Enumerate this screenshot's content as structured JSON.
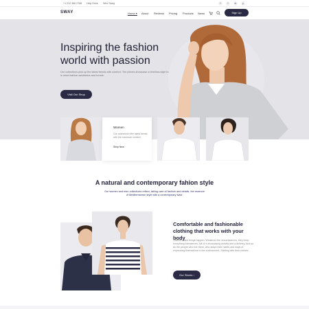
{
  "topbar": {
    "phone": "+1 212 386 2788",
    "help": "Help Desk",
    "location": "Who Sway",
    "social": [
      "f",
      "t",
      "in",
      "y"
    ]
  },
  "nav": {
    "logo": "SWAY",
    "menu": [
      "Home",
      "About",
      "Reviews",
      "Pricing",
      "Products",
      "News"
    ],
    "active_index": 0,
    "cart_icon": "cart-icon",
    "search_icon": "search-icon",
    "signup_label": "Sign Up"
  },
  "hero": {
    "title": "Inspiring the fashion world with passion",
    "text": "Our collections pick up the latest trends with comfort. The pieces showcase a timeless style but keeping in mind fashion aesthetics and trends.",
    "button": "Visit Our Shop"
  },
  "category_card": {
    "title": "Women",
    "text": "Our collections offer latest trends with the maximum comfort.",
    "link": "Shop Now"
  },
  "section": {
    "title": "A natural and contemporary fahion style",
    "subtitle": "Our women and men collections reflect, taking care of fashion and details, the essence of Mediterranean style with a contemporary twist."
  },
  "feature": {
    "title": "Comfortable and fashionable clothing that works with your body",
    "text": "Clothes make things happen. Whatever the circumstances, they keep everything themselves, full of a showcasing activity and a delivery. And so do the people who live there, who adopt their habits and ways of expressing themselves to the environment. Starting with their clothes.",
    "button": "Our Stores"
  },
  "colors": {
    "accent": "#2a2a44",
    "hero_bg": "#e3e3e8"
  }
}
